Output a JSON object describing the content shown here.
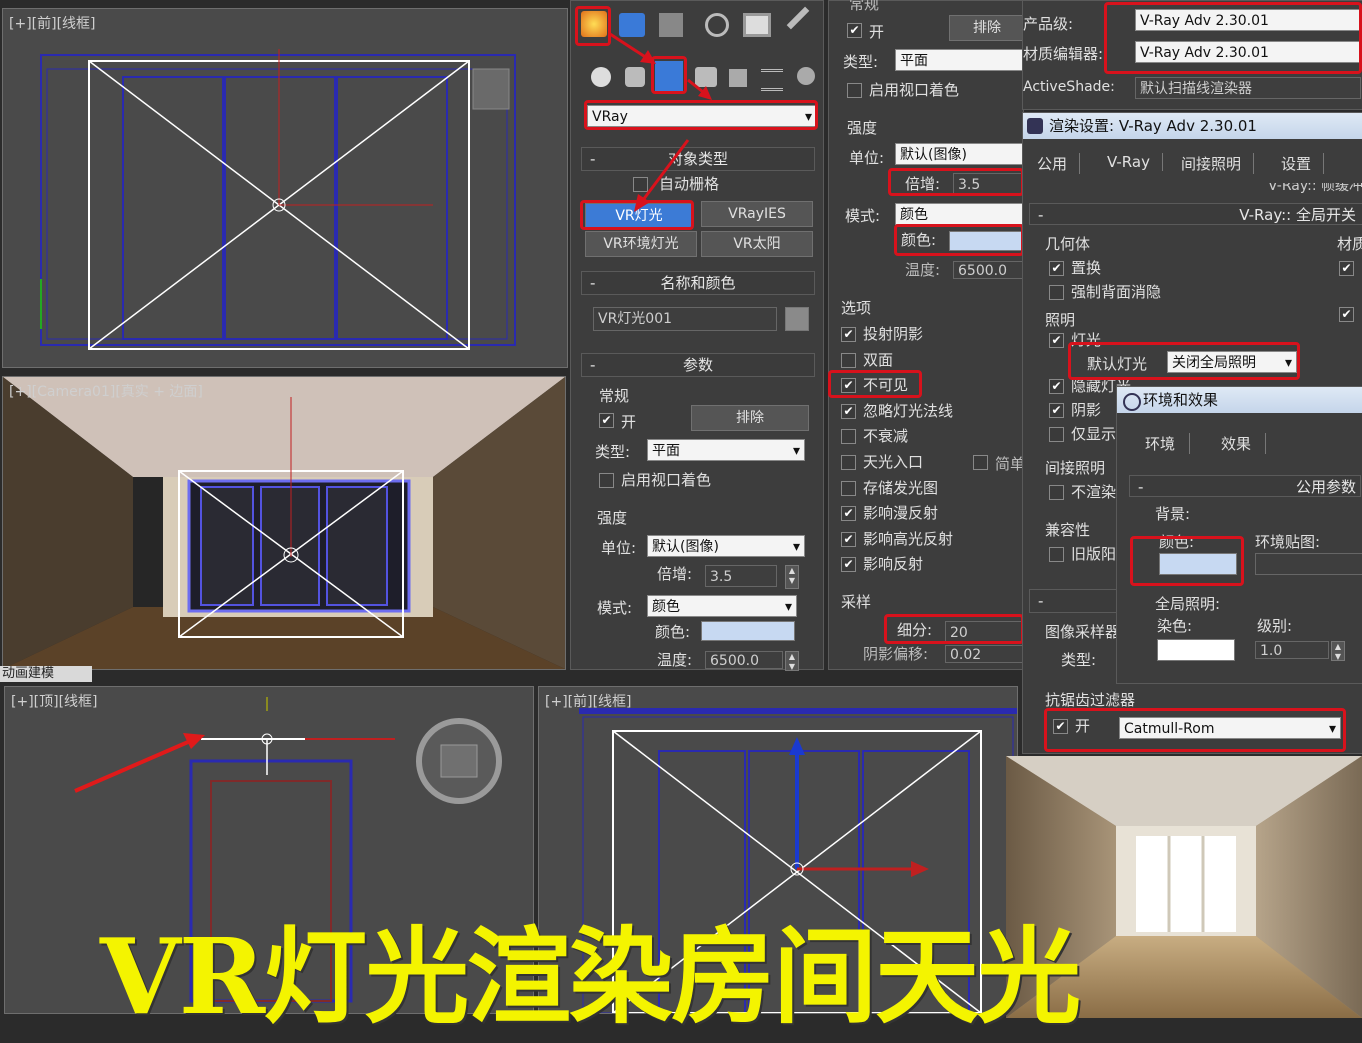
{
  "viewports": {
    "front": "[+][前][线框]",
    "camera": "[+][Camera01][真实 + 边面]",
    "top": "[+][顶][线框]",
    "front2": "[+][前][线框]",
    "strip": "动画建模"
  },
  "command_panel": {
    "dropdown": "VRay",
    "object_type": {
      "header": "对象类型",
      "autogrid": "自动栅格",
      "buttons": [
        "VR灯光",
        "VRayIES",
        "VR环境灯光",
        "VR太阳"
      ]
    },
    "name_color": {
      "header": "名称和颜色",
      "name": "VR灯光001"
    },
    "params": {
      "header": "参数",
      "general": "常规",
      "on": "开",
      "exclude": "排除",
      "type_label": "类型:",
      "type_value": "平面",
      "viewport_color": "启用视口着色",
      "intensity": "强度",
      "unit_label": "单位:",
      "unit_value": "默认(图像)",
      "mult_label": "倍增:",
      "mult_value": "3.5",
      "mode_label": "模式:",
      "mode_value": "颜色",
      "color_label": "颜色:",
      "temp_label": "温度:",
      "temp_value": "6500.0"
    }
  },
  "light_panel": {
    "general": "常规",
    "on": "开",
    "exclude": "排除",
    "type_label": "类型:",
    "type_value": "平面",
    "viewport_color": "启用视口着色",
    "intensity": "强度",
    "unit_label": "单位:",
    "unit_value": "默认(图像)",
    "mult_label": "倍增:",
    "mult_value": "3.5",
    "mode_label": "模式:",
    "mode_value": "颜色",
    "color_label": "颜色:",
    "temp_label": "温度:",
    "temp_value": "6500.0",
    "options": {
      "header": "选项",
      "items": [
        "投射阴影",
        "双面",
        "不可见",
        "忽略灯光法线",
        "不衰减",
        "天光入口",
        "存储发光图",
        "影响漫反射",
        "影响高光反射",
        "影响反射"
      ],
      "checked": [
        true,
        false,
        true,
        true,
        false,
        false,
        false,
        true,
        true,
        true
      ],
      "simple": "简单"
    },
    "sampling": {
      "header": "采样",
      "subdiv_label": "细分:",
      "subdiv_value": "20",
      "shadow_bias_label": "阴影偏移:",
      "shadow_bias_value": "0.02"
    }
  },
  "renderer": {
    "product_label": "产品级:",
    "product_value": "V-Ray Adv 2.30.01",
    "mat_label": "材质编辑器:",
    "mat_value": "V-Ray Adv 2.30.01",
    "active_label": "ActiveShade:",
    "active_value": "默认扫描线渲染器"
  },
  "render_setup": {
    "title": "渲染设置: V-Ray Adv 2.30.01",
    "tabs": [
      "公用",
      "V-Ray",
      "间接照明",
      "设置"
    ],
    "rollout_top": "V-Ray:: 帧缓冲",
    "rollout": "V-Ray:: 全局开关",
    "geometry": "几何体",
    "displacement": "置换",
    "backface": "强制背面消隐",
    "material": "材质",
    "lighting": "照明",
    "lights": "灯光",
    "default_lights_label": "默认灯光",
    "default_lights_value": "关闭全局照明",
    "hidden_lights": "隐藏灯光",
    "shadows": "阴影",
    "show_gi_only": "仅显示全局照明",
    "indirect": "间接照明",
    "no_render": "不渲染最终的图像",
    "compat": "兼容性",
    "legacy": "旧版阳光/天光/摄影机模型",
    "img_sampler": "图像采样器",
    "type_label": "类型:",
    "aa_header": "抗锯齿过滤器",
    "aa_on": "开",
    "aa_value": "Catmull-Rom"
  },
  "env_dialog": {
    "title": "环境和效果",
    "tabs": [
      "环境",
      "效果"
    ],
    "rollout": "公用参数",
    "background": "背景:",
    "color_label": "颜色:",
    "env_map_label": "环境贴图:",
    "gi_header": "全局照明:",
    "tint_label": "染色:",
    "level_label": "级别:",
    "level_value": "1.0"
  },
  "caption": "VR灯光渲染房间天光",
  "colors": {
    "annotation_red": "#d8121c",
    "caption_yellow": "#f4f400",
    "light_blue_swatch": "#c7d9f2",
    "selected_blue": "#3c7bd6"
  }
}
